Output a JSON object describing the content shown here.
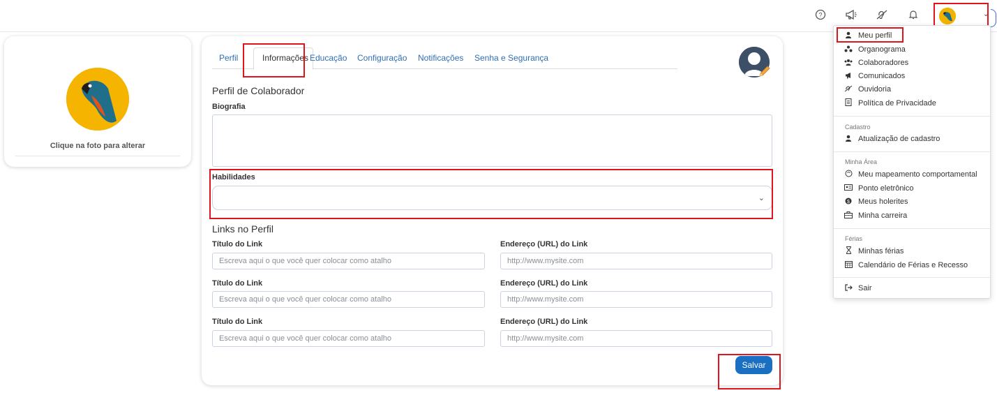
{
  "topbar": {
    "icons": [
      "help-icon",
      "megaphone-icon",
      "ear-icon",
      "bell-icon"
    ],
    "caret": "⌄"
  },
  "left_card": {
    "caption": "Clique na foto para alterar"
  },
  "tabs": [
    {
      "label": "Perfil",
      "active": false
    },
    {
      "label": "Informações",
      "active": true
    },
    {
      "label": "Educação",
      "active": false
    },
    {
      "label": "Configuração",
      "active": false
    },
    {
      "label": "Notificações",
      "active": false
    },
    {
      "label": "Senha e Segurança",
      "active": false
    }
  ],
  "form": {
    "profile_title": "Perfil de Colaborador",
    "bio_label": "Biografia",
    "bio_value": "",
    "skills_label": "Habilidades",
    "skills_value": "",
    "links_title": "Links no Perfil",
    "link_title_label": "Título do Link",
    "link_url_label": "Endereço (URL) do Link",
    "link_title_placeholder": "Escreva aqui o que você quer colocar como atalho",
    "link_url_placeholder": "http://www.mysite.com",
    "save_label": "Salvar"
  },
  "menu": {
    "items_top": [
      {
        "label": "Meu perfil",
        "icon": "user-icon"
      },
      {
        "label": "Organograma",
        "icon": "org-chart-icon"
      },
      {
        "label": "Colaboradores",
        "icon": "users-icon"
      },
      {
        "label": "Comunicados",
        "icon": "megaphone-icon"
      },
      {
        "label": "Ouvidoria",
        "icon": "ear-icon"
      },
      {
        "label": "Política de Privacidade",
        "icon": "document-icon"
      }
    ],
    "section_cadastro": "Cadastro",
    "items_cadastro": [
      {
        "label": "Atualização de cadastro",
        "icon": "user-icon"
      }
    ],
    "section_area": "Minha Área",
    "items_area": [
      {
        "label": "Meu mapeamento comportamental",
        "icon": "brain-icon"
      },
      {
        "label": "Ponto eletrônico",
        "icon": "id-card-icon"
      },
      {
        "label": "Meus holerites",
        "icon": "money-icon"
      },
      {
        "label": "Minha carreira",
        "icon": "briefcase-icon"
      }
    ],
    "section_ferias": "Férias",
    "items_ferias": [
      {
        "label": "Minhas férias",
        "icon": "hourglass-icon"
      },
      {
        "label": "Calendário de Férias e Recesso",
        "icon": "calendar-icon"
      }
    ],
    "logout_label": "Sair"
  }
}
